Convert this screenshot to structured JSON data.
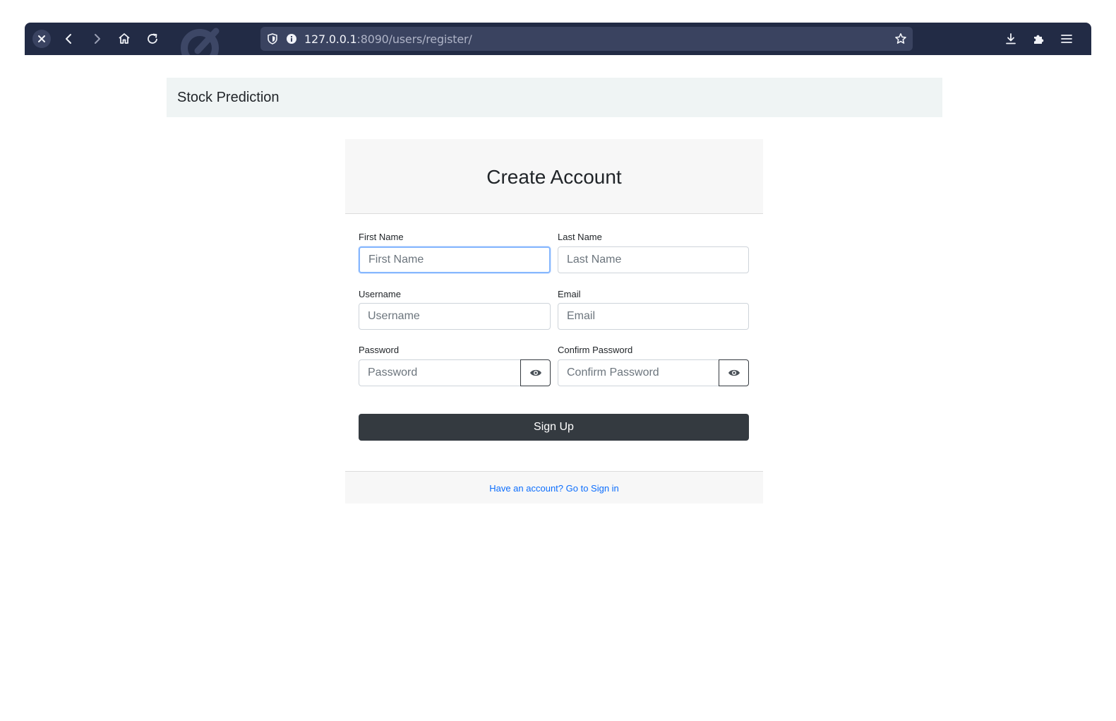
{
  "browser": {
    "url_host": "127.0.0.1",
    "url_path": ":8090/users/register/",
    "icons": [
      "close-icon",
      "back-icon",
      "forward-icon",
      "home-icon",
      "reload-icon",
      "shield-icon",
      "info-icon",
      "star-icon",
      "download-icon",
      "extensions-icon",
      "menu-icon"
    ]
  },
  "navbar": {
    "brand": "Stock Prediction"
  },
  "form": {
    "title": "Create Account",
    "first_name": {
      "label": "First Name",
      "placeholder": "First Name",
      "value": ""
    },
    "last_name": {
      "label": "Last Name",
      "placeholder": "Last Name",
      "value": ""
    },
    "username": {
      "label": "Username",
      "placeholder": "Username",
      "value": ""
    },
    "email": {
      "label": "Email",
      "placeholder": "Email",
      "value": ""
    },
    "password": {
      "label": "Password",
      "placeholder": "Password",
      "value": ""
    },
    "confirm_password": {
      "label": "Confirm Password",
      "placeholder": "Confirm Password",
      "value": ""
    },
    "submit_label": "Sign Up",
    "signin_link": "Have an account? Go to Sign in"
  },
  "colors": {
    "chrome_bg": "#222b45",
    "navbar_bg": "#eff4f4",
    "button_dark": "#343a40",
    "link": "#0d6efd",
    "focus_border": "#86b7fe"
  }
}
